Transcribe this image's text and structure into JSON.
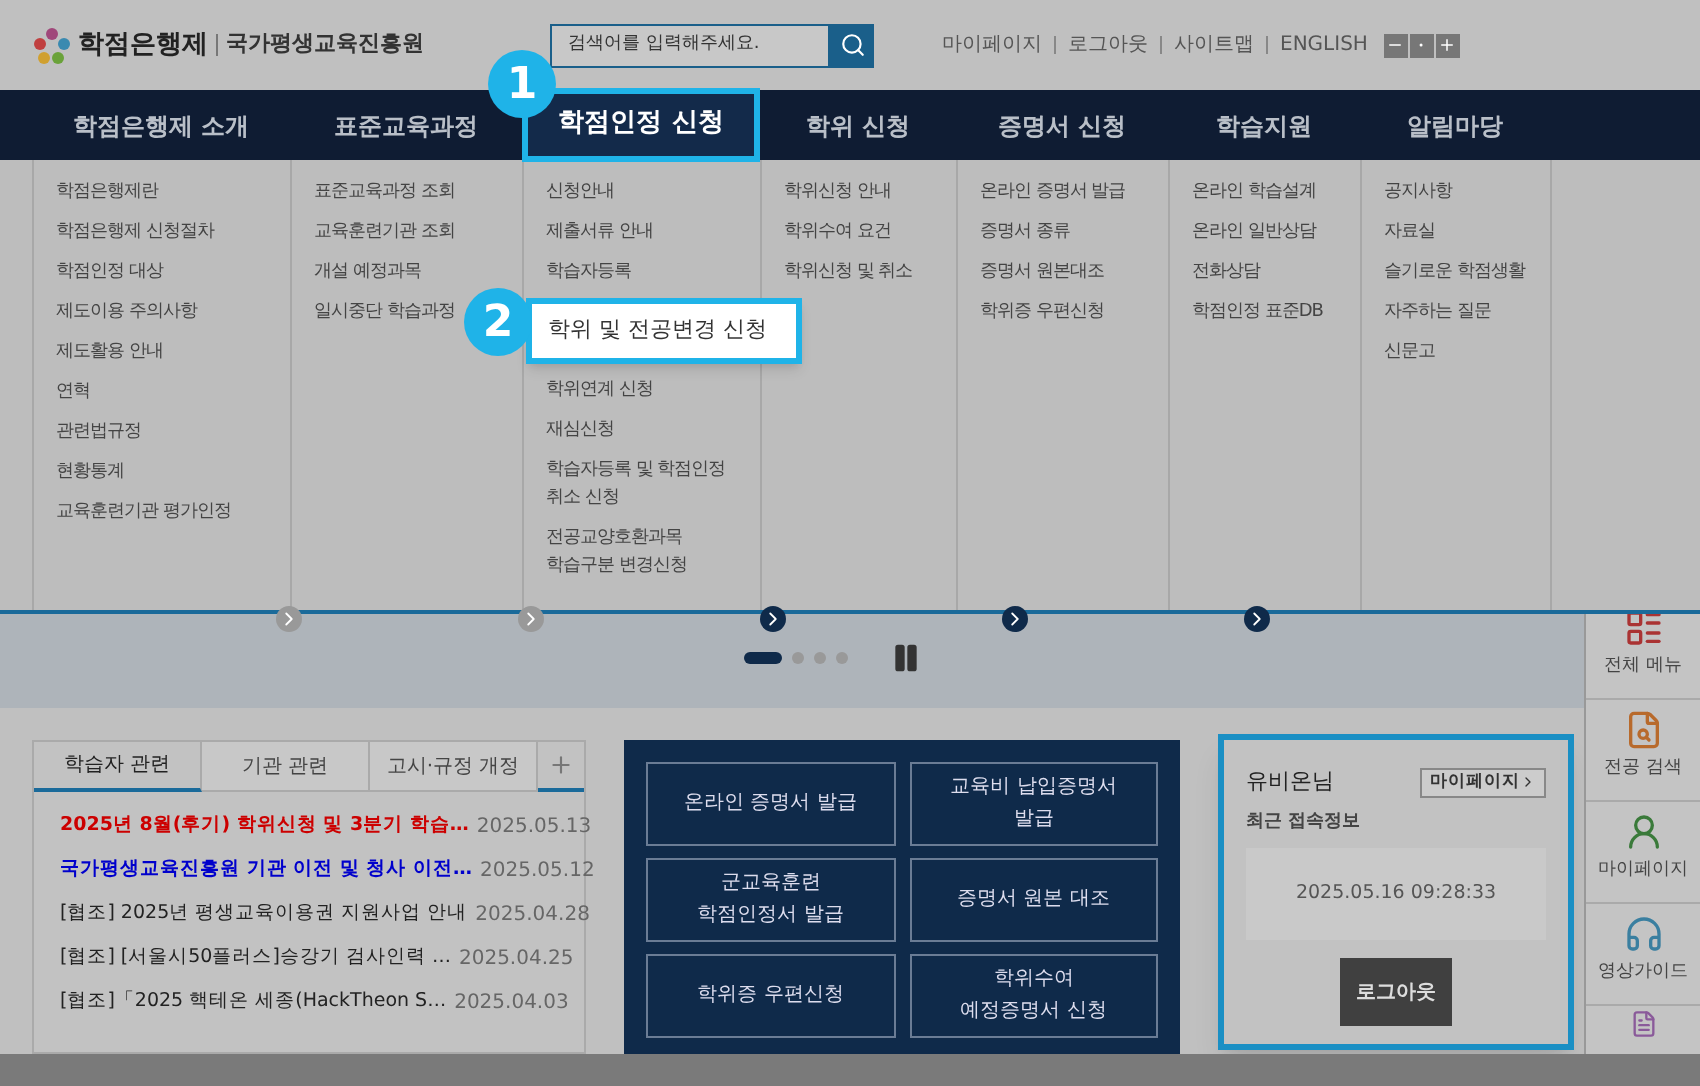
{
  "header": {
    "logo_text": "학점은행제",
    "org_name": "국가평생교육진흥원",
    "search": {
      "placeholder": "검색어를 입력해주세요."
    },
    "links": [
      "마이페이지",
      "로그아웃",
      "사이트맵",
      "ENGLISH"
    ]
  },
  "callouts": [
    "1",
    "2"
  ],
  "nav": [
    {
      "label": "학점은행제 소개",
      "selected": false,
      "items": [
        {
          "label": "학점은행제란"
        },
        {
          "label": "학점은행제 신청절차"
        },
        {
          "label": "학점인정 대상"
        },
        {
          "label": "제도이용 주의사항"
        },
        {
          "label": "제도활용 안내"
        },
        {
          "label": "연혁"
        },
        {
          "label": "관련법규정"
        },
        {
          "label": "현황통계"
        },
        {
          "label": "교육훈련기관 평가인정"
        }
      ]
    },
    {
      "label": "표준교육과정",
      "selected": false,
      "items": [
        {
          "label": "표준교육과정 조회"
        },
        {
          "label": "교육훈련기관 조회"
        },
        {
          "label": "개설 예정과목"
        },
        {
          "label": "일시중단 학습과정"
        }
      ]
    },
    {
      "label": "학점인정 신청",
      "selected": true,
      "items": [
        {
          "label": "신청안내",
          "highlighted": false
        },
        {
          "label": "제출서류 안내",
          "highlighted": false
        },
        {
          "label": "학습자등록",
          "highlighted": false
        },
        {
          "label": "학위 및 전공변경 신청",
          "highlighted": true
        },
        {
          "label": "학위연계 신청",
          "highlighted": false
        },
        {
          "label": "재심신청",
          "highlighted": false
        },
        {
          "label": "학습자등록 및 학점인정\n취소 신청",
          "highlighted": false
        },
        {
          "label": "전공교양호환과목\n학습구분 변경신청",
          "highlighted": false
        }
      ]
    },
    {
      "label": "학위 신청",
      "selected": false,
      "items": [
        {
          "label": "학위신청 안내"
        },
        {
          "label": "학위수여 요건"
        },
        {
          "label": "학위신청 및 취소"
        }
      ]
    },
    {
      "label": "증명서 신청",
      "selected": false,
      "items": [
        {
          "label": "온라인 증명서 발급"
        },
        {
          "label": "증명서 종류"
        },
        {
          "label": "증명서 원본대조"
        },
        {
          "label": "학위증 우편신청"
        }
      ]
    },
    {
      "label": "학습지원",
      "selected": false,
      "items": [
        {
          "label": "온라인 학습설계"
        },
        {
          "label": "온라인 일반상담"
        },
        {
          "label": "전화상담"
        },
        {
          "label": "학점인정 표준DB"
        }
      ]
    },
    {
      "label": "알림마당",
      "selected": false,
      "items": [
        {
          "label": "공지사항"
        },
        {
          "label": "자료실"
        },
        {
          "label": "슬기로운 학점생활"
        },
        {
          "label": "자주하는 질문"
        },
        {
          "label": "신문고"
        }
      ]
    }
  ],
  "slider": {
    "pager": [
      {
        "selected": true
      },
      {
        "selected": false
      },
      {
        "selected": false
      },
      {
        "selected": false
      }
    ]
  },
  "notice_tabs": [
    {
      "label": "학습자 관련",
      "selected": true
    },
    {
      "label": "기관 관련",
      "selected": false
    },
    {
      "label": "고시·규정 개정",
      "selected": false
    }
  ],
  "notices": [
    {
      "title": "2025년 8월(후기) 학위신청 및 3분기 학습…",
      "date": "2025.05.13",
      "color": "#cc0000"
    },
    {
      "title": "국가평생교육진흥원 기관 이전 및 청사 이전…",
      "date": "2025.05.12",
      "color": "#0000cc"
    },
    {
      "title": "[협조] 2025년 평생교육이용권 지원사업 안내",
      "date": "2025.04.28",
      "color": "#222222"
    },
    {
      "title": "[협조] [서울시50플러스]승강기 검사인력 …",
      "date": "2025.04.25",
      "color": "#222222"
    },
    {
      "title": "[협조]「2025 핵테온 세종(HackTheon S…",
      "date": "2025.04.03",
      "color": "#222222"
    }
  ],
  "quick_buttons": [
    "온라인 증명서 발급",
    "교육비 납입증명서\n발급",
    "군교육훈련\n학점인정서 발급",
    "증명서 원본 대조",
    "학위증 우편신청",
    "학위수여\n예정증명서 신청"
  ],
  "user": {
    "name": "유비온님",
    "mypage_button": "마이페이지",
    "recent_label": "최근 접속정보",
    "last_login": "2025.05.16 09:28:33",
    "logout_button": "로그아웃"
  },
  "side_menu": [
    {
      "kind": "menu",
      "label": "전체 메뉴"
    },
    {
      "kind": "search",
      "label": "전공 검색"
    },
    {
      "kind": "user",
      "label": "마이페이지"
    },
    {
      "kind": "guide",
      "label": "영상가이드"
    },
    {
      "kind": "form"
    }
  ]
}
